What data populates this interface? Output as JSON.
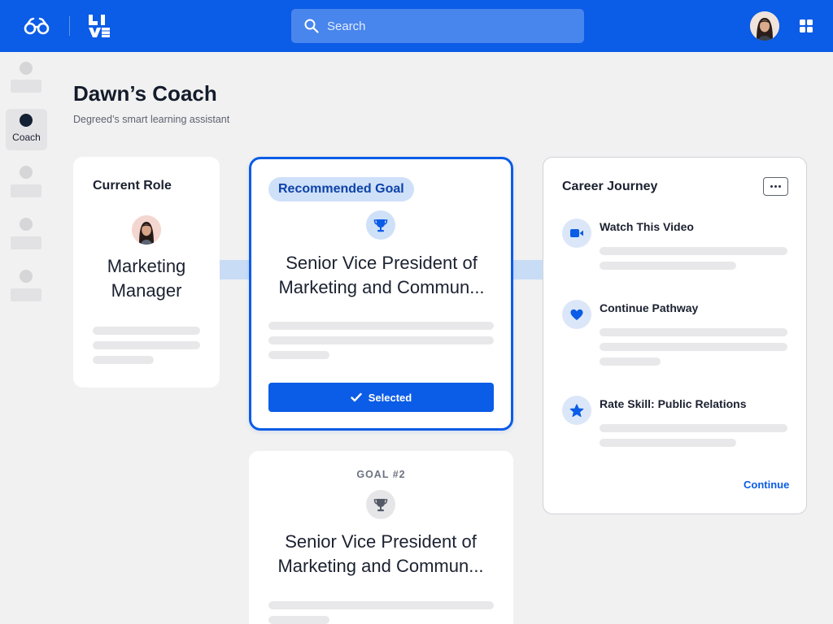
{
  "header": {
    "search_placeholder": "Search"
  },
  "sidebar": {
    "active_item_label": "Coach"
  },
  "page": {
    "title": "Dawn’s Coach",
    "subtitle": "Degreed’s smart learning assistant"
  },
  "current_role": {
    "heading": "Current Role",
    "role_line1": "Marketing",
    "role_line2": "Manager"
  },
  "recommended_goal": {
    "badge": "Recommended Goal",
    "title_line1": "Senior Vice President of",
    "title_line2": "Marketing and Commun...",
    "button_label": "Selected"
  },
  "goal_2": {
    "label": "GOAL #2",
    "title_line1": "Senior Vice President of",
    "title_line2": "Marketing and Commun..."
  },
  "career_journey": {
    "heading": "Career Journey",
    "steps": [
      {
        "title": "Watch This Video",
        "icon": "video-camera-icon"
      },
      {
        "title": "Continue Pathway",
        "icon": "heart-icon"
      },
      {
        "title": "Rate Skill: Public Relations",
        "icon": "star-icon"
      }
    ],
    "continue_label": "Continue"
  },
  "colors": {
    "brand_blue": "#0b5ce6",
    "icon_bg_light_blue": "#dbe7f8",
    "badge_bg": "#cfe0f9",
    "connector": "#c9dcf6"
  }
}
